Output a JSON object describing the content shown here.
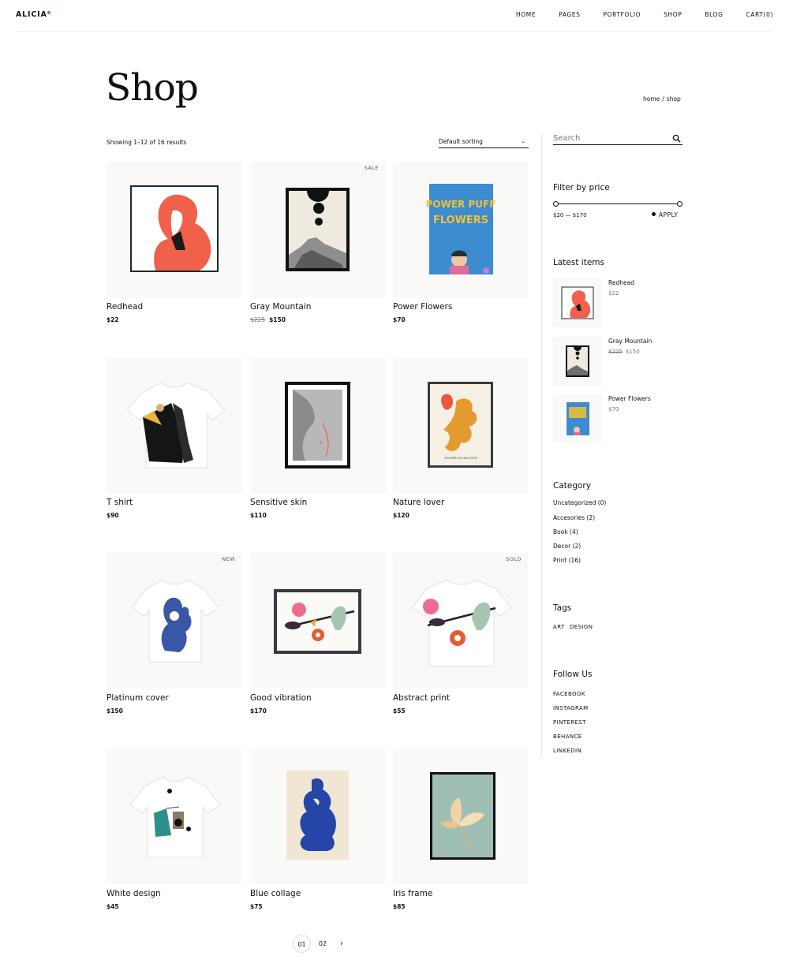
{
  "header": {
    "logo": "ALICIA",
    "nav": [
      "HOME",
      "PAGES",
      "PORTFOLIO",
      "SHOP",
      "BLOG",
      "CART(0)"
    ]
  },
  "page": {
    "title": "Shop",
    "breadcrumb": [
      "home",
      "/",
      "shop"
    ],
    "results_text": "Showing 1–12 of 16 results",
    "sort_label": "Default sorting"
  },
  "products": [
    {
      "name": "Redhead",
      "price": "$22",
      "old_price": "",
      "badge": ""
    },
    {
      "name": "Gray Mountain",
      "price": "$150",
      "old_price": "$225",
      "badge": "SALE"
    },
    {
      "name": "Power Flowers",
      "price": "$70",
      "old_price": "",
      "badge": ""
    },
    {
      "name": "T shirt",
      "price": "$90",
      "old_price": "",
      "badge": ""
    },
    {
      "name": "Sensitive skin",
      "price": "$110",
      "old_price": "",
      "badge": ""
    },
    {
      "name": "Nature lover",
      "price": "$120",
      "old_price": "",
      "badge": ""
    },
    {
      "name": "Platinum cover",
      "price": "$150",
      "old_price": "",
      "badge": "NEW"
    },
    {
      "name": "Good vibration",
      "price": "$170",
      "old_price": "",
      "badge": ""
    },
    {
      "name": "Abstract print",
      "price": "$55",
      "old_price": "",
      "badge": "SOLD"
    },
    {
      "name": "White design",
      "price": "$45",
      "old_price": "",
      "badge": ""
    },
    {
      "name": "Blue collage",
      "price": "$75",
      "old_price": "",
      "badge": ""
    },
    {
      "name": "Iris frame",
      "price": "$85",
      "old_price": "",
      "badge": ""
    }
  ],
  "artwork_text": {
    "poster_line1": "POWER PUFF",
    "poster_line2": "FLOWERS",
    "nature_caption": "POSTER COLLECTION"
  },
  "pagination": {
    "pages": [
      "01",
      "02"
    ],
    "current": "01",
    "next": "›"
  },
  "sidebar": {
    "search_placeholder": "Search",
    "filter_title": "Filter by price",
    "price_range": "$20 — $170",
    "apply_label": "APPLY",
    "latest_title": "Latest items",
    "latest": [
      {
        "name": "Redhead",
        "price": "$22",
        "old_price": ""
      },
      {
        "name": "Gray Mountain",
        "price": "$150",
        "old_price": "$225"
      },
      {
        "name": "Power Flowers",
        "price": "$70",
        "old_price": ""
      }
    ],
    "category_title": "Category",
    "categories": [
      "Uncategorized (0)",
      "Accesories (2)",
      "Book (4)",
      "Decor (2)",
      "Print (16)"
    ],
    "tags_title": "Tags",
    "tags": [
      "ART",
      "DESIGN"
    ],
    "follow_title": "Follow Us",
    "social": [
      "FACEBOOK",
      "INSTAGRAM",
      "PINTEREST",
      "BEHANCE",
      "LINKEDIN"
    ]
  },
  "colors": {
    "accent": "#e8553b",
    "text": "#111111",
    "card_bg": "#faf9f7",
    "divider": "#e2e2e2"
  }
}
